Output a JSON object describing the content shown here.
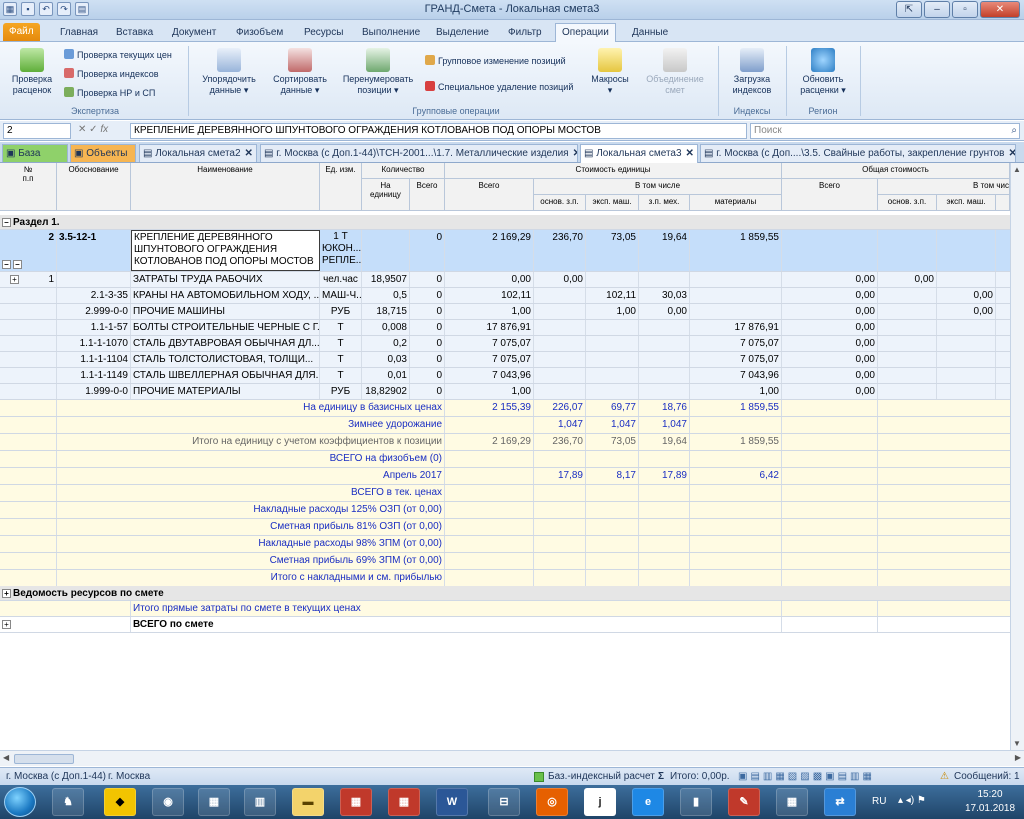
{
  "window": {
    "title": "ГРАНД-Смета - Локальная смета3"
  },
  "ribbon_tabs": [
    "Файл",
    "Главная",
    "Вставка",
    "Документ",
    "Физобъем",
    "Ресурсы",
    "Выполнение",
    "Выделение",
    "Фильтр",
    "Операции",
    "Данные"
  ],
  "ribbon": {
    "expertise": {
      "check_prices": "Проверка\nрасценок",
      "check_current": "Проверка текущих цен",
      "check_indexes": "Проверка индексов",
      "check_nr_sp": "Проверка НР и СП",
      "group_label": "Экспертиза"
    },
    "group_ops": {
      "order": "Упорядочить\nданные ▾",
      "sort": "Сортировать\nданные ▾",
      "renumber": "Перенумеровать\nпозиции ▾",
      "group_change": "Групповое изменение позиций",
      "special_delete": "Специальное удаление позиций",
      "macros": "Макросы\n▾",
      "merge": "Объединение\nсмет",
      "group_label": "Групповые операции"
    },
    "indexes": {
      "load": "Загрузка\nиндексов",
      "group_label": "Индексы"
    },
    "region": {
      "update": "Обновить\nрасценки ▾",
      "group_label": "Регион"
    }
  },
  "formula_bar": {
    "cell": "2",
    "value": "КРЕПЛЕНИЕ ДЕРЕВЯННОГО ШПУНТОВОГО ОГРАЖДЕНИЯ КОТЛОВАНОВ ПОД ОПОРЫ МОСТОВ",
    "search_placeholder": "Поиск"
  },
  "doc_tabs": [
    {
      "label": "База"
    },
    {
      "label": "Объекты"
    },
    {
      "label": "Локальная смета2"
    },
    {
      "label": "г. Москва (с Доп.1-44)\\ТСН-2001...\\1.7. Металлические изделия"
    },
    {
      "label": "Локальная смета3"
    },
    {
      "label": "г. Москва (с Доп....\\3.5. Свайные работы, закрепление грунтов"
    }
  ],
  "grid_headers": {
    "num": "№\nп.п",
    "basis": "Обоснование",
    "name": "Наименование",
    "unit": "Ед. изм.",
    "qty": "Количество",
    "qty_per_unit": "На\nединицу",
    "qty_total": "Всего",
    "unit_cost": "Стоимость единицы",
    "total": "Всего",
    "including": "В том числе",
    "ozp": "основ. з.п.",
    "em": "эксп. маш.",
    "zpm": "з.п. мех.",
    "mat": "материалы",
    "total_cost": "Общая стоимость",
    "total2": "Всего",
    "including2": "В том чис",
    "ozp2": "основ. з.п.",
    "em2": "эксп. маш."
  },
  "section1": "Раздел 1.",
  "position": {
    "num": "2",
    "basis": "3.5-12-1",
    "name_lines": [
      "КРЕПЛЕНИЕ ДЕРЕВЯННОГО",
      "ШПУНТОВОГО ОГРАЖДЕНИЯ",
      "КОТЛОВАНОВ ПОД ОПОРЫ МОСТОВ"
    ],
    "unit_lines": [
      "1 Т",
      "ЮКОН...",
      "РЕПЛЕ..."
    ],
    "qty_total": "0",
    "total": "2 169,29",
    "ozp": "236,70",
    "em": "73,05",
    "zpm": "19,64",
    "mat": "1 859,55"
  },
  "resources": [
    {
      "num": "1",
      "basis": "",
      "name": "ЗАТРАТЫ ТРУДА РАБОЧИХ",
      "unit": "чел.час",
      "qty": "18,9507",
      "qty_total": "0",
      "total": "0,00",
      "ozp": "0,00",
      "em": "",
      "zpm": "",
      "mat": "",
      "t2": "0,00",
      "t2ozp": "0,00",
      "t2em": ""
    },
    {
      "num": "",
      "basis": "2.1-3-35",
      "name": "КРАНЫ НА АВТОМОБИЛЬНОМ ХОДУ, ...",
      "unit": "МАШ-Ч...",
      "qty": "0,5",
      "qty_total": "0",
      "total": "102,11",
      "ozp": "",
      "em": "102,11",
      "zpm": "30,03",
      "mat": "",
      "t2": "0,00",
      "t2ozp": "",
      "t2em": "0,00"
    },
    {
      "num": "",
      "basis": "2.999-0-0",
      "name": "ПРОЧИЕ МАШИНЫ",
      "unit": "РУБ",
      "qty": "18,715",
      "qty_total": "0",
      "total": "1,00",
      "ozp": "",
      "em": "1,00",
      "zpm": "0,00",
      "mat": "",
      "t2": "0,00",
      "t2ozp": "",
      "t2em": "0,00"
    },
    {
      "num": "",
      "basis": "1.1-1-57",
      "name": "БОЛТЫ СТРОИТЕЛЬНЫЕ ЧЕРНЫЕ С Г...",
      "unit": "Т",
      "qty": "0,008",
      "qty_total": "0",
      "total": "17 876,91",
      "ozp": "",
      "em": "",
      "zpm": "",
      "mat": "17 876,91",
      "t2": "0,00",
      "t2ozp": "",
      "t2em": ""
    },
    {
      "num": "",
      "basis": "1.1-1-1070",
      "name": "СТАЛЬ ДВУТАВРОВАЯ ОБЫЧНАЯ ДЛ...",
      "unit": "Т",
      "qty": "0,2",
      "qty_total": "0",
      "total": "7 075,07",
      "ozp": "",
      "em": "",
      "zpm": "",
      "mat": "7 075,07",
      "t2": "0,00",
      "t2ozp": "",
      "t2em": ""
    },
    {
      "num": "",
      "basis": "1.1-1-1104",
      "name": "СТАЛЬ ТОЛСТОЛИСТОВАЯ, ТОЛЩИ...",
      "unit": "Т",
      "qty": "0,03",
      "qty_total": "0",
      "total": "7 075,07",
      "ozp": "",
      "em": "",
      "zpm": "",
      "mat": "7 075,07",
      "t2": "0,00",
      "t2ozp": "",
      "t2em": ""
    },
    {
      "num": "",
      "basis": "1.1-1-1149",
      "name": "СТАЛЬ ШВЕЛЛЕРНАЯ ОБЫЧНАЯ ДЛЯ...",
      "unit": "Т",
      "qty": "0,01",
      "qty_total": "0",
      "total": "7 043,96",
      "ozp": "",
      "em": "",
      "zpm": "",
      "mat": "7 043,96",
      "t2": "0,00",
      "t2ozp": "",
      "t2em": ""
    },
    {
      "num": "",
      "basis": "1.999-0-0",
      "name": "ПРОЧИЕ МАТЕРИАЛЫ",
      "unit": "РУБ",
      "qty": "18,82902",
      "qty_total": "0",
      "total": "1,00",
      "ozp": "",
      "em": "",
      "zpm": "",
      "mat": "1,00",
      "t2": "0,00",
      "t2ozp": "",
      "t2em": ""
    }
  ],
  "summary": [
    {
      "label": "На единицу в базисных ценах",
      "style": "blue",
      "total": "2 155,39",
      "ozp": "226,07",
      "em": "69,77",
      "zpm": "18,76",
      "mat": "1 859,55"
    },
    {
      "label": "Зимнее удорожание",
      "style": "blue",
      "total": "",
      "ozp": "1,047",
      "em": "1,047",
      "zpm": "1,047",
      "mat": ""
    },
    {
      "label": "Итого на единицу с учетом коэффициентов к позиции",
      "style": "gray",
      "total": "2 169,29",
      "ozp": "236,70",
      "em": "73,05",
      "zpm": "19,64",
      "mat": "1 859,55"
    },
    {
      "label": "ВСЕГО на физобъем (0)",
      "style": "blue",
      "total": "",
      "ozp": "",
      "em": "",
      "zpm": "",
      "mat": ""
    },
    {
      "label": "Апрель 2017",
      "style": "blue",
      "total": "",
      "ozp": "17,89",
      "em": "8,17",
      "zpm": "17,89",
      "mat": "6,42"
    },
    {
      "label": "ВСЕГО в тек. ценах",
      "style": "blue",
      "total": "",
      "ozp": "",
      "em": "",
      "zpm": "",
      "mat": ""
    },
    {
      "label": "Накладные расходы 125% ОЗП (от 0,00)",
      "style": "blue",
      "total": "",
      "ozp": "",
      "em": "",
      "zpm": "",
      "mat": ""
    },
    {
      "label": "Сметная прибыль 81% ОЗП (от 0,00)",
      "style": "blue",
      "total": "",
      "ozp": "",
      "em": "",
      "zpm": "",
      "mat": ""
    },
    {
      "label": "Накладные расходы 98% ЗПМ (от 0,00)",
      "style": "blue",
      "total": "",
      "ozp": "",
      "em": "",
      "zpm": "",
      "mat": ""
    },
    {
      "label": "Сметная прибыль 69% ЗПМ (от 0,00)",
      "style": "blue",
      "total": "",
      "ozp": "",
      "em": "",
      "zpm": "",
      "mat": ""
    },
    {
      "label": "Итого с накладными и см. прибылью",
      "style": "blue",
      "total": "",
      "ozp": "",
      "em": "",
      "zpm": "",
      "mat": ""
    }
  ],
  "resources_section": "Ведомость ресурсов по смете",
  "direct_costs": "Итого прямые затраты по смете в текущих ценах",
  "grand_total": "ВСЕГО по смете",
  "status": {
    "region": "г. Москва (с Доп.1-44)",
    "region2": "г. Москва",
    "calc_mode": "Баз.-индексный расчет",
    "total": "Итого: 0,00р.",
    "messages": "Сообщений: 1"
  },
  "taskbar": {
    "lang": "RU",
    "time": "15:20",
    "date": "17.01.2018"
  }
}
